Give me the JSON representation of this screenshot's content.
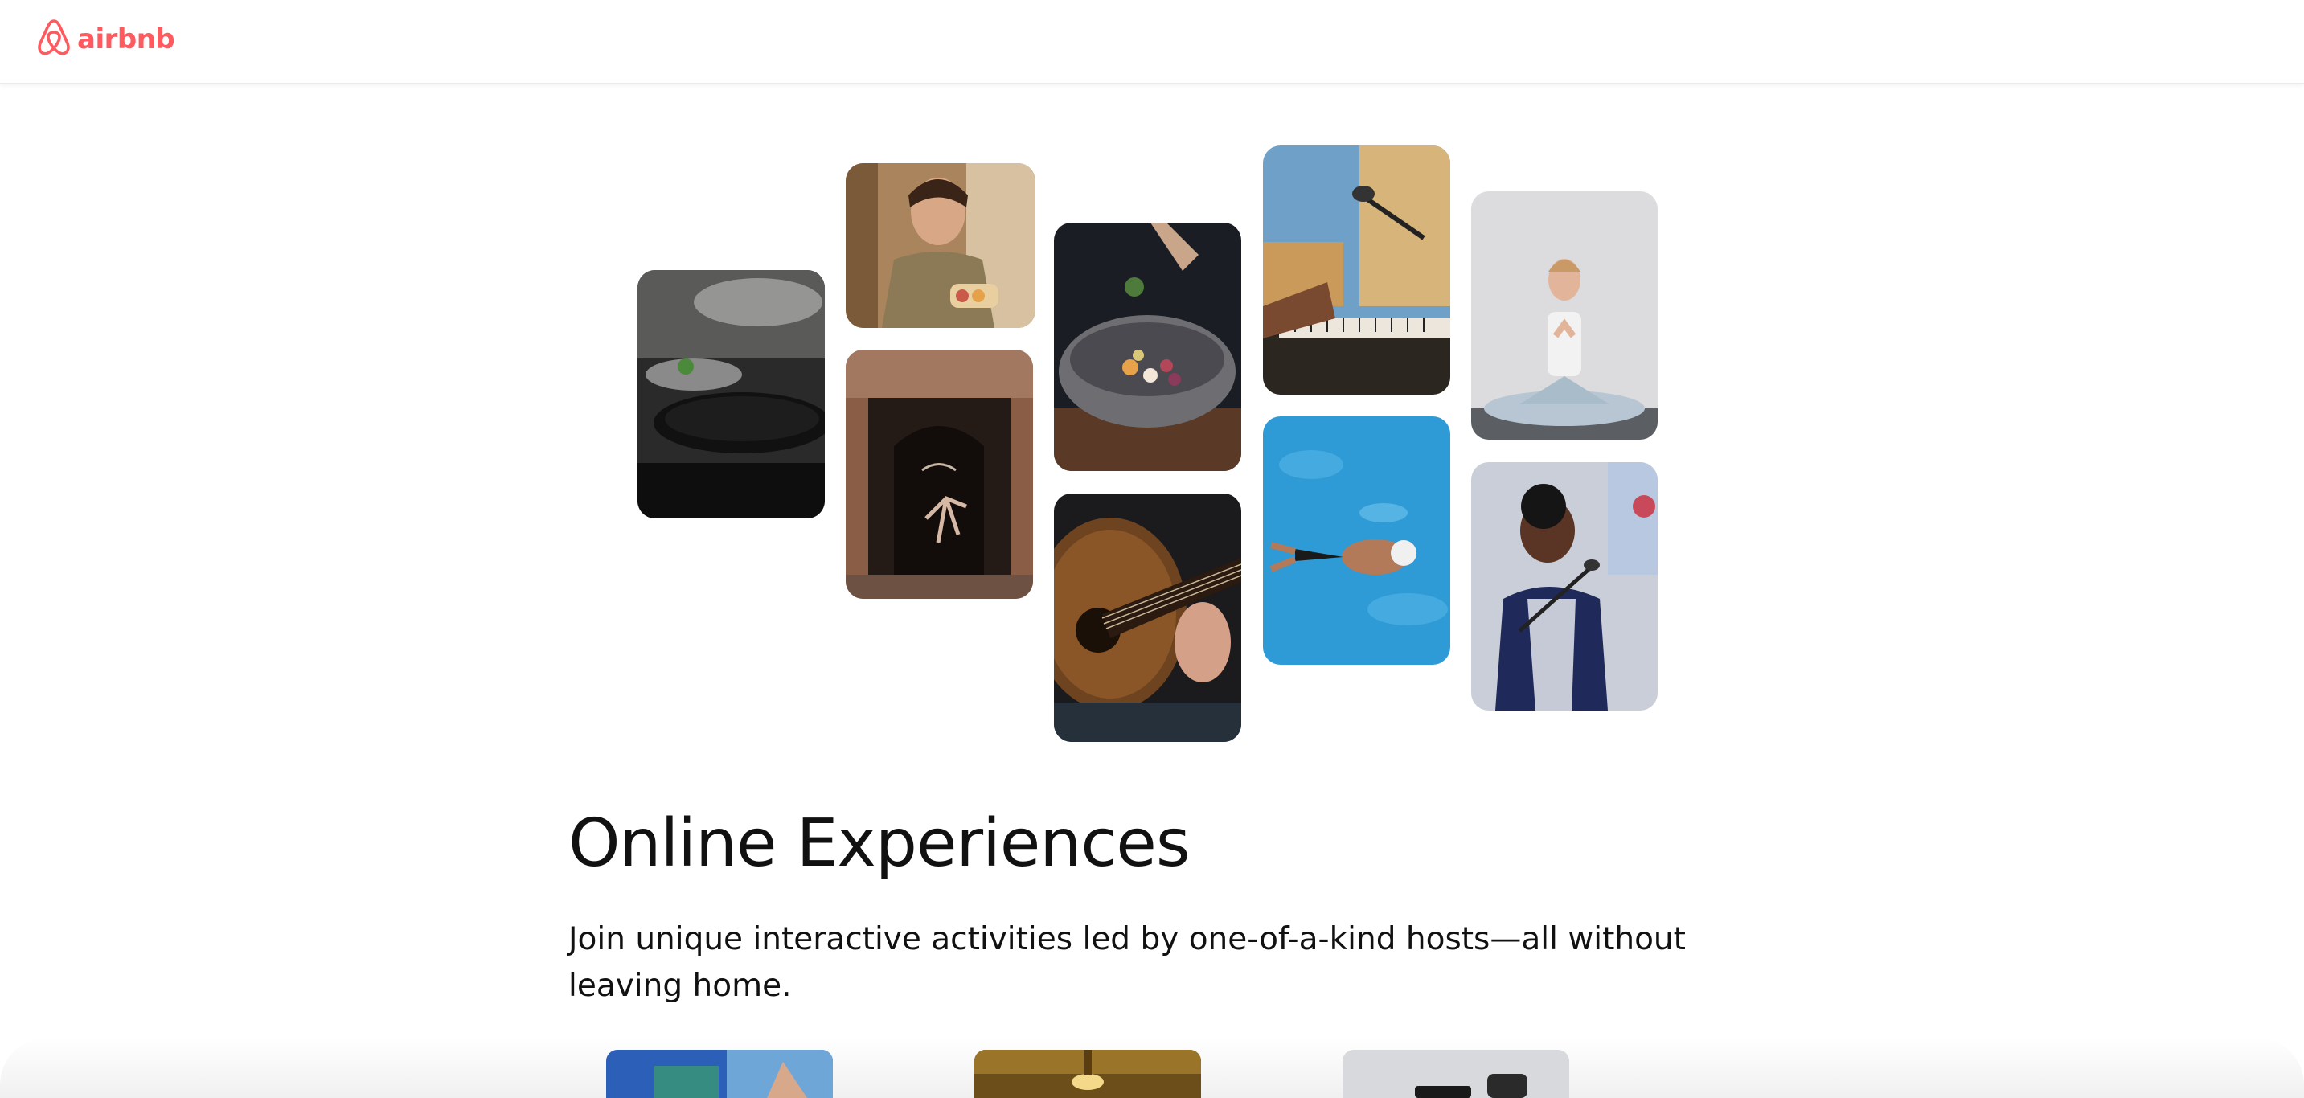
{
  "header": {
    "brand": "airbnb",
    "brand_color": "#FF5A5F",
    "logo_icon": "airbnb-belo-icon"
  },
  "hero": {
    "images": [
      {
        "name": "cooking-pans-photo"
      },
      {
        "name": "woman-with-pastries-photo"
      },
      {
        "name": "dancer-in-doorway-photo"
      },
      {
        "name": "stone-bowl-dish-photo"
      },
      {
        "name": "acoustic-guitar-photo"
      },
      {
        "name": "piano-microphone-photo"
      },
      {
        "name": "swimmer-pool-photo"
      },
      {
        "name": "yoga-meditation-photo"
      },
      {
        "name": "singer-microphone-photo"
      }
    ]
  },
  "main": {
    "title": "Online Experiences",
    "subtitle": "Join unique interactive activities led by one-of-a-kind hosts—all without leaving home."
  },
  "cards": [
    {
      "name": "experience-card-1"
    },
    {
      "name": "experience-card-2"
    },
    {
      "name": "experience-card-3"
    }
  ]
}
